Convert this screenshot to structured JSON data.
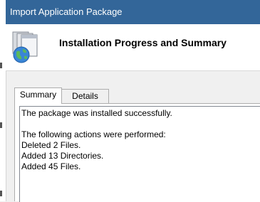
{
  "window": {
    "title": "Import Application Package",
    "titlebar_color": "#336699"
  },
  "header": {
    "heading": "Installation Progress and Summary",
    "icon": "package-globe-icon"
  },
  "tabs": [
    {
      "label": "Summary",
      "active": true
    },
    {
      "label": "Details",
      "active": false
    }
  ],
  "summary": {
    "lines": [
      "The package was installed successfully.",
      "",
      "The following actions were performed:",
      "Deleted 2 Files.",
      "Added 13 Directories.",
      "Added 45 Files."
    ]
  }
}
